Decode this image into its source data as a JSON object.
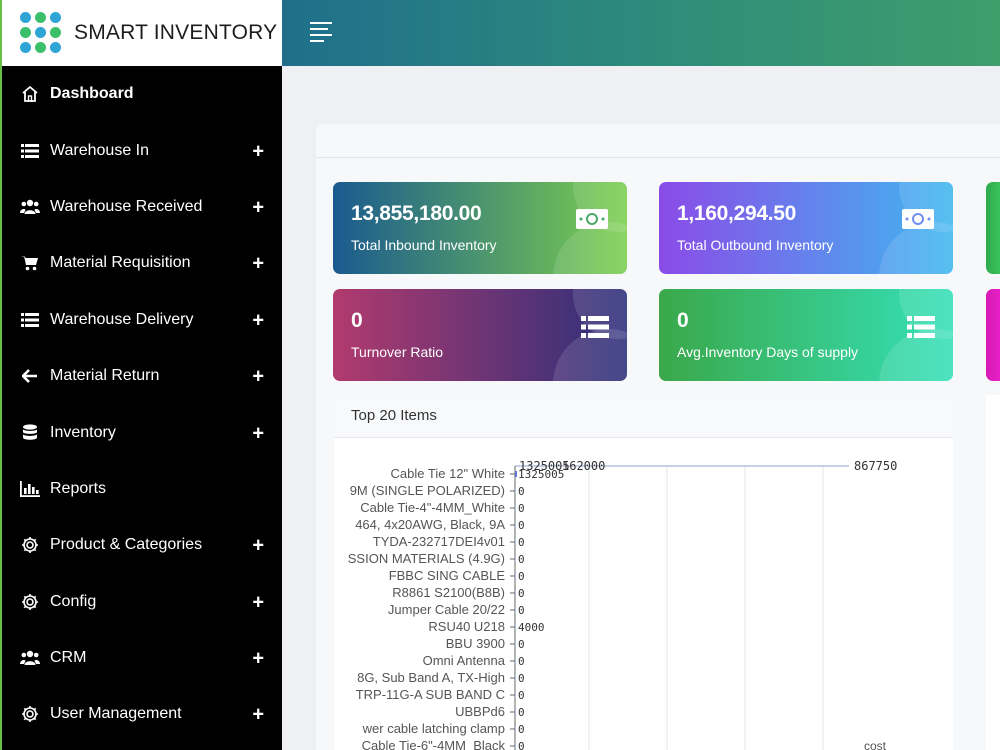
{
  "brand": {
    "title": "SMART INVENTORY"
  },
  "sidebar": {
    "items": [
      {
        "label": "Dashboard",
        "icon": "home-icon",
        "has_plus": false,
        "active": true
      },
      {
        "label": "Warehouse In",
        "icon": "list-icon",
        "has_plus": true
      },
      {
        "label": "Warehouse Received",
        "icon": "users-icon",
        "has_plus": true
      },
      {
        "label": "Material Requisition",
        "icon": "cart-icon",
        "has_plus": true
      },
      {
        "label": "Warehouse Delivery",
        "icon": "list-icon",
        "has_plus": true
      },
      {
        "label": "Material Return",
        "icon": "arrow-left-icon",
        "has_plus": true
      },
      {
        "label": "Inventory",
        "icon": "database-icon",
        "has_plus": true
      },
      {
        "label": "Reports",
        "icon": "bar-chart-icon",
        "has_plus": false
      },
      {
        "label": "Product & Categories",
        "icon": "gear-icon",
        "has_plus": true
      },
      {
        "label": "Config",
        "icon": "gear-icon",
        "has_plus": true
      },
      {
        "label": "CRM",
        "icon": "users-icon",
        "has_plus": true
      },
      {
        "label": "User Management",
        "icon": "gear-icon",
        "has_plus": true
      }
    ],
    "plus_symbol": "+"
  },
  "cards": [
    {
      "value": "13,855,180.00",
      "label": "Total Inbound Inventory",
      "icon": "money-icon",
      "colors": [
        "#1b5a8f",
        "#7ccf4e"
      ]
    },
    {
      "value": "1,160,294.50",
      "label": "Total Outbound Inventory",
      "icon": "money-icon",
      "colors": [
        "#8b4be8",
        "#3fb7f0"
      ]
    },
    {
      "value": "0",
      "label": "Turnover Ratio",
      "icon": "list-icon",
      "colors": [
        "#b23a6e",
        "#2b2f7a"
      ]
    },
    {
      "value": "0",
      "label": "Avg.Inventory Days of supply",
      "icon": "list-icon",
      "colors": [
        "#3aa84a",
        "#35e0b8"
      ]
    }
  ],
  "chart_section": {
    "title": "Top 20 Items"
  },
  "chart_data": {
    "type": "bar",
    "orientation": "horizontal",
    "categories": [
      "Cable Tie 12\" White",
      "9M (SINGLE POLARIZED)",
      "Cable Tie-4\"-4MM_White",
      "464, 4x20AWG, Black, 9A",
      "TYDA-232717DEI4v01",
      "SSION MATERIALS (4.9G)",
      "FBBC SING CABLE",
      "R8861 S2100(B8B)",
      "Jumper Cable 20/22",
      "RSU40 U218",
      "BBU 3900",
      "Omni Antenna",
      "8G, Sub Band A, TX-High",
      "TRP-11G-A SUB BAND C",
      "UBBPd6",
      "wer cable latching clamp",
      "Cable Tie-6\"-4MM_Black"
    ],
    "series": [
      {
        "name": "cost",
        "values": [
          1325005,
          0,
          0,
          0,
          0,
          0,
          0,
          0,
          0,
          4000,
          0,
          0,
          0,
          0,
          0,
          0,
          0
        ]
      }
    ],
    "top_axis_labels": [
      "1325005",
      "162000",
      "867750"
    ],
    "xlabel": "cost",
    "grid": true
  }
}
